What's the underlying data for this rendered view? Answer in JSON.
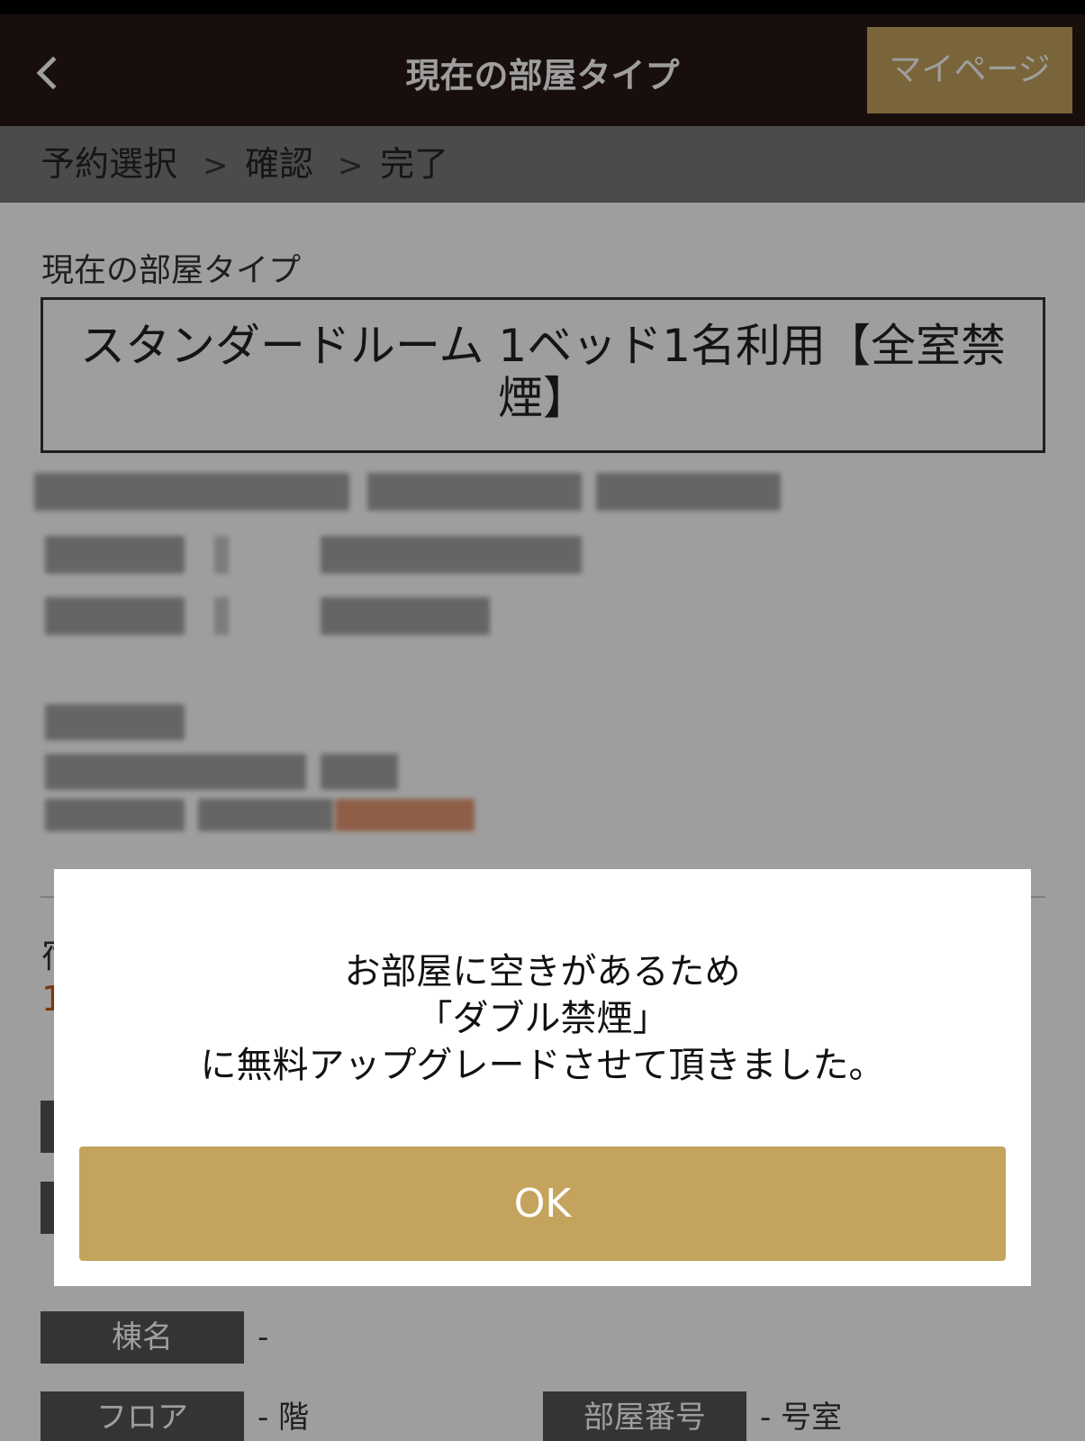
{
  "header": {
    "title": "現在の部屋タイプ",
    "mypage_label": "マイページ"
  },
  "steps": [
    {
      "label": "予約選択"
    },
    {
      "label": "確認"
    },
    {
      "label": "完了"
    }
  ],
  "step_separator": ">",
  "content": {
    "section_label": "現在の部屋タイプ",
    "room_type": "スタンダードルーム 1ベッド1名利用【全室禁煙】",
    "peek_text": "宿",
    "peek_orange": "1"
  },
  "info": {
    "building_label": "棟名",
    "building_value": "-",
    "floor_label": "フロア",
    "floor_value": "- 階",
    "room_number_label": "部屋番号",
    "room_number_value": "- 号室"
  },
  "modal": {
    "line1": "お部屋に空きがあるため",
    "line2": "「ダブル禁煙」",
    "line3": "に無料アップグレードさせて頂きました。",
    "ok_label": "OK"
  },
  "colors": {
    "header_bg": "#271916",
    "accent_gold": "#c4a45c",
    "label_bg": "#555555"
  }
}
